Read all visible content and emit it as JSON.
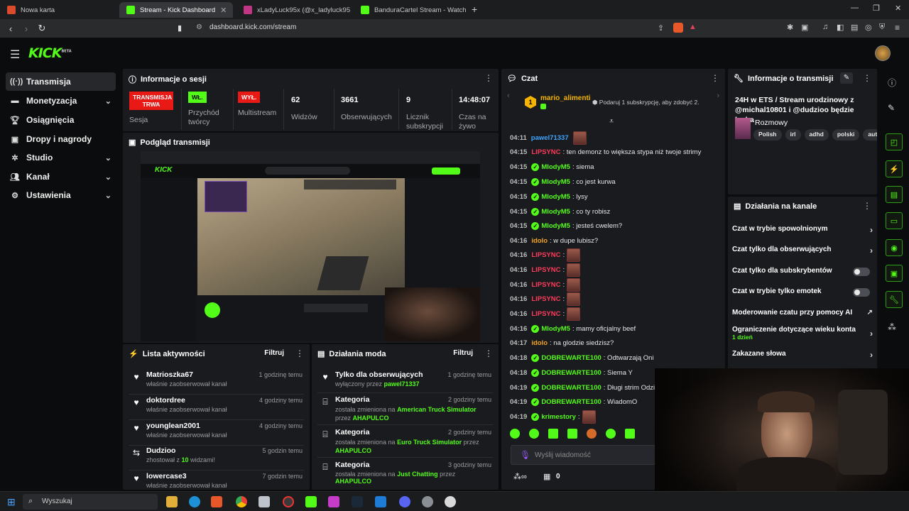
{
  "browser": {
    "tabs": [
      {
        "title": "Nowa karta",
        "color": "#d94b2b"
      },
      {
        "title": "Stream - Kick Dashboard",
        "color": "#53fc18"
      },
      {
        "title": "xLadyLuck95x (@x_ladyluck95_x) • Zd",
        "color": "#c13584"
      },
      {
        "title": "BanduraCartel Stream - Watch Live o",
        "color": "#53fc18"
      }
    ],
    "url": "dashboard.kick.com/stream"
  },
  "kick": {
    "logo": "KICK",
    "beta": "BETA"
  },
  "sidebar": {
    "items": [
      {
        "label": "Transmisja",
        "icon": "broadcast-icon"
      },
      {
        "label": "Monetyzacja",
        "icon": "money-icon"
      },
      {
        "label": "Osiągnięcia",
        "icon": "trophy-icon"
      },
      {
        "label": "Dropy i nagrody",
        "icon": "gift-icon"
      },
      {
        "label": "Studio",
        "icon": "gear-icon"
      },
      {
        "label": "Kanał",
        "icon": "people-icon"
      },
      {
        "label": "Ustawienia",
        "icon": "settings-icon"
      }
    ]
  },
  "session": {
    "title": "Informacje o sesji",
    "stats": [
      {
        "badge": "TRANSMISJA TRWA",
        "label": "Sesja"
      },
      {
        "badge": "WŁ.",
        "label": "Przychód twórcy"
      },
      {
        "badge": "WYŁ.",
        "label": "Multistream"
      },
      {
        "value": "62",
        "label": "Widzów"
      },
      {
        "value": "3661",
        "label": "Obserwujących"
      },
      {
        "value": "9",
        "label": "Licznik subskrypcji"
      },
      {
        "value": "14:48:07",
        "label": "Czas na żywo"
      }
    ]
  },
  "preview": {
    "title": "Podgląd transmisji"
  },
  "activity": {
    "title": "Lista aktywności",
    "filter": "Filtruj",
    "items": [
      {
        "name": "Matrioszka67",
        "sub": "właśnie zaobserwował kanał",
        "time": "1 godzinę temu"
      },
      {
        "name": "doktordree",
        "sub": "właśnie zaobserwował kanał",
        "time": "4 godziny temu"
      },
      {
        "name": "younglean2001",
        "sub": "właśnie zaobserwował kanał",
        "time": "4 godziny temu"
      },
      {
        "name": "Dudzioo",
        "sub_a": "zhostował z ",
        "sub_b": "10",
        "sub_c": " widzami!",
        "time": "5 godzin temu"
      },
      {
        "name": "lowercase3",
        "sub": "właśnie zaobserwował kanał",
        "time": "7 godzin temu"
      }
    ]
  },
  "modactions": {
    "title": "Działania moda",
    "filter": "Filtruj",
    "items": [
      {
        "name": "Tylko dla obserwujących",
        "pre": "wyłączony przez ",
        "green": "pawel71337",
        "post": "",
        "time": "1 godzinę temu"
      },
      {
        "name": "Kategoria",
        "pre": "została zmieniona na ",
        "green": "American Truck Simulator",
        "post": " przez ",
        "green2": "AHAPULCO",
        "time": "2 godziny temu"
      },
      {
        "name": "Kategoria",
        "pre": "została zmieniona na ",
        "green": "Euro Truck Simulator",
        "post": " przez ",
        "green2": "AHAPULCO",
        "time": "2 godziny temu"
      },
      {
        "name": "Kategoria",
        "pre": "została zmieniona na ",
        "green": "Just Chatting",
        "post": " przez ",
        "green2": "AHAPULCO",
        "time": "3 godziny temu"
      }
    ]
  },
  "chat": {
    "title": "Czat",
    "pinned_user": "mario_alimenti",
    "pinned_rank": "1",
    "pinned_gift": "Podaruj 1 subskrypcję, aby zdobyć 2.",
    "input_placeholder": "Wyślij wiadomość",
    "points": "0",
    "messages": [
      {
        "time": "04:11",
        "user": "pawel71337",
        "color": "#3ea6ff",
        "text": "",
        "emote": true
      },
      {
        "time": "04:15",
        "user": "LIPSYNC",
        "color": "#ff3b5c",
        "text": ": ten demonz to większa stypa niż twoje strimy"
      },
      {
        "time": "04:15",
        "user": "MlodyM5",
        "color": "#53fc18",
        "text": ": siema"
      },
      {
        "time": "04:15",
        "user": "MlodyM5",
        "color": "#53fc18",
        "text": ": co jest kurwa"
      },
      {
        "time": "04:15",
        "user": "MlodyM5",
        "color": "#53fc18",
        "text": ": lysy"
      },
      {
        "time": "04:15",
        "user": "MlodyM5",
        "color": "#53fc18",
        "text": ": co ty robisz"
      },
      {
        "time": "04:15",
        "user": "MlodyM5",
        "color": "#53fc18",
        "text": ": jesteś cwelem?"
      },
      {
        "time": "04:16",
        "user": "idolo",
        "color": "#f5a623",
        "text": ": w dupe lubisz?"
      },
      {
        "time": "04:16",
        "user": "LIPSYNC",
        "color": "#ff3b5c",
        "text": ":",
        "emote": true
      },
      {
        "time": "04:16",
        "user": "LIPSYNC",
        "color": "#ff3b5c",
        "text": ":",
        "emote": true
      },
      {
        "time": "04:16",
        "user": "LIPSYNC",
        "color": "#ff3b5c",
        "text": ":",
        "emote": true
      },
      {
        "time": "04:16",
        "user": "LIPSYNC",
        "color": "#ff3b5c",
        "text": ":",
        "emote": true
      },
      {
        "time": "04:16",
        "user": "LIPSYNC",
        "color": "#ff3b5c",
        "text": ":",
        "emote": true
      },
      {
        "time": "04:16",
        "user": "MlodyM5",
        "color": "#53fc18",
        "text": ": mamy oficjalny beef"
      },
      {
        "time": "04:17",
        "user": "idolo",
        "color": "#f5a623",
        "text": ": na glodzie siedzisz?"
      },
      {
        "time": "04:18",
        "user": "DOBREWARTE100",
        "color": "#53fc18",
        "text": ": Odtwarzają Oni"
      },
      {
        "time": "04:18",
        "user": "DOBREWARTE100",
        "color": "#53fc18",
        "text": ": Siema Y"
      },
      {
        "time": "04:19",
        "user": "DOBREWARTE100",
        "color": "#53fc18",
        "text": ": Długi strim OdziwO"
      },
      {
        "time": "04:19",
        "user": "DOBREWARTE100",
        "color": "#53fc18",
        "text": ": WiadomO"
      },
      {
        "time": "04:19",
        "user": "krimestory",
        "color": "#53fc18",
        "text": ":",
        "emote": true
      }
    ]
  },
  "streaminfo": {
    "title": "Informacje o transmisji",
    "stream_title": "24H w ETS / Stream urodzinowy z @michal10801 i @dudzioo będzie łycha",
    "category": "Rozmowy",
    "tags": [
      "Polish",
      "irl",
      "adhd",
      "polski",
      "autis"
    ]
  },
  "channelactions": {
    "title": "Działania na kanale",
    "items": [
      {
        "label": "Czat w trybie spowolnionym",
        "kind": "chevron"
      },
      {
        "label": "Czat tylko dla obserwujących",
        "kind": "chevron"
      },
      {
        "label": "Czat tylko dla subskrybentów",
        "kind": "toggle"
      },
      {
        "label": "Czat w trybie tylko emotek",
        "kind": "toggle"
      },
      {
        "label": "Moderowanie czatu przy pomocy AI",
        "kind": "external"
      },
      {
        "label": "Ograniczenie dotyczące wieku konta",
        "sub": "1 dzień",
        "kind": "chevron"
      },
      {
        "label": "Zakazane słowa",
        "kind": "chevron"
      }
    ]
  },
  "taskbar": {
    "search": "Wyszukaj"
  },
  "colors": {
    "accent": "#53fc18",
    "live_red": "#e91916",
    "panel": "#191b1f"
  }
}
